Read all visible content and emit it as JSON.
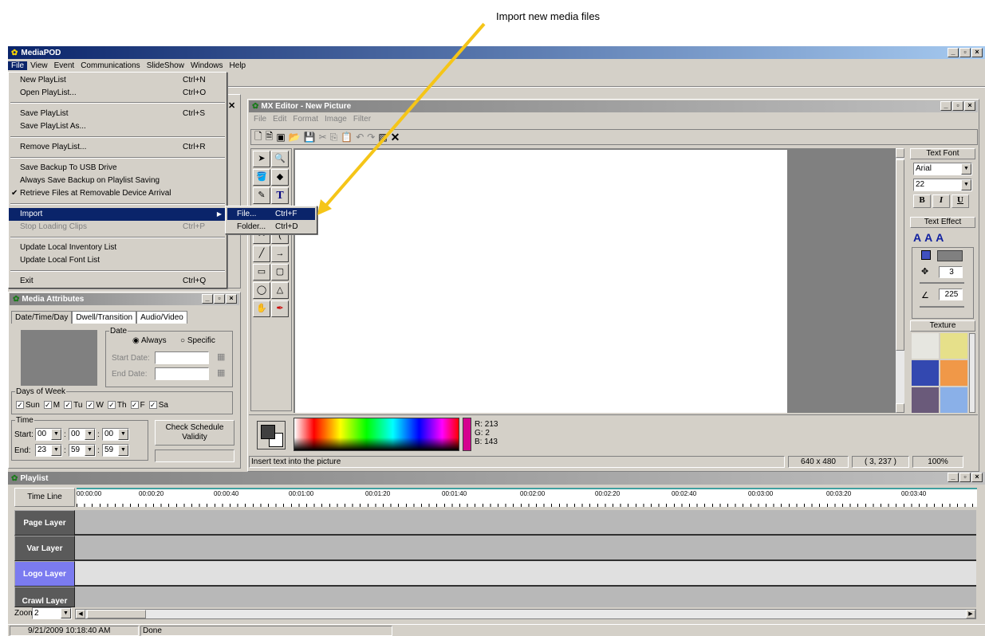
{
  "annotation": {
    "text": "Import new media files"
  },
  "app": {
    "title": "MediaPOD"
  },
  "menubar": [
    "File",
    "View",
    "Event",
    "Communications",
    "SlideShow",
    "Windows",
    "Help"
  ],
  "file_menu": {
    "new_playlist": {
      "label": "New PlayList",
      "shortcut": "Ctrl+N"
    },
    "open_playlist": {
      "label": "Open PlayList...",
      "shortcut": "Ctrl+O"
    },
    "save_playlist": {
      "label": "Save PlayList",
      "shortcut": "Ctrl+S"
    },
    "save_playlist_as": {
      "label": "Save PlayList As..."
    },
    "remove_playlist": {
      "label": "Remove PlayList...",
      "shortcut": "Ctrl+R"
    },
    "save_backup": {
      "label": "Save Backup To USB Drive"
    },
    "always_save_backup": {
      "label": "Always Save Backup on Playlist Saving"
    },
    "retrieve_files": {
      "label": "Retrieve Files at Removable Device Arrival"
    },
    "import": {
      "label": "Import"
    },
    "stop_loading": {
      "label": "Stop Loading Clips",
      "shortcut": "Ctrl+P"
    },
    "update_inventory": {
      "label": "Update Local Inventory List"
    },
    "update_font": {
      "label": "Update Local Font List"
    },
    "exit": {
      "label": "Exit",
      "shortcut": "Ctrl+Q"
    }
  },
  "import_submenu": {
    "file": {
      "label": "File...",
      "shortcut": "Ctrl+F"
    },
    "folder": {
      "label": "Folder...",
      "shortcut": "Ctrl+D"
    }
  },
  "mx_editor": {
    "title": "MX Editor - New Picture",
    "menus": [
      "File",
      "Edit",
      "Format",
      "Image",
      "Filter"
    ],
    "status_text": "Insert text into the picture",
    "size": "640 x 480",
    "coords": "( 3, 237 )",
    "zoom": "100%",
    "color": {
      "r": "R: 213",
      "g": "G: 2",
      "b": "B: 143",
      "hex": "#d5028f"
    },
    "text_font_label": "Text Font",
    "font_name": "Arial",
    "font_size": "22",
    "text_effect_label": "Text Effect",
    "effect_value_1": "3",
    "effect_value_2": "225",
    "texture_label": "Texture"
  },
  "media_attributes": {
    "title": "Media Attributes",
    "tabs": [
      "Date/Time/Day",
      "Dwell/Transition",
      "Audio/Video"
    ],
    "date_group": "Date",
    "always": "Always",
    "specific": "Specific",
    "start_date": "Start Date:",
    "end_date": "End Date:",
    "days_group": "Days of Week",
    "days": [
      "Sun",
      "M",
      "Tu",
      "W",
      "Th",
      "F",
      "Sa"
    ],
    "time_group": "Time",
    "start": "Start:",
    "end": "End:",
    "start_h": "00",
    "start_m": "00",
    "start_s": "00",
    "end_h": "23",
    "end_m": "59",
    "end_s": "59",
    "check_button": "Check Schedule Validity"
  },
  "playlist": {
    "title": "Playlist",
    "timeline_label": "Time Line",
    "ticks": [
      "00:00:00",
      "00:00:20",
      "00:00:40",
      "00:01:00",
      "00:01:20",
      "00:01:40",
      "00:02:00",
      "00:02:20",
      "00:02:40",
      "00:03:00",
      "00:03:20",
      "00:03:40"
    ],
    "layers": [
      "Page Layer",
      "Var Layer",
      "Logo Layer",
      "Crawl Layer"
    ],
    "zoom_label": "Zoom",
    "zoom_value": "2"
  },
  "statusbar": {
    "datetime": "9/21/2009 10:18:40 AM",
    "status": "Done"
  }
}
